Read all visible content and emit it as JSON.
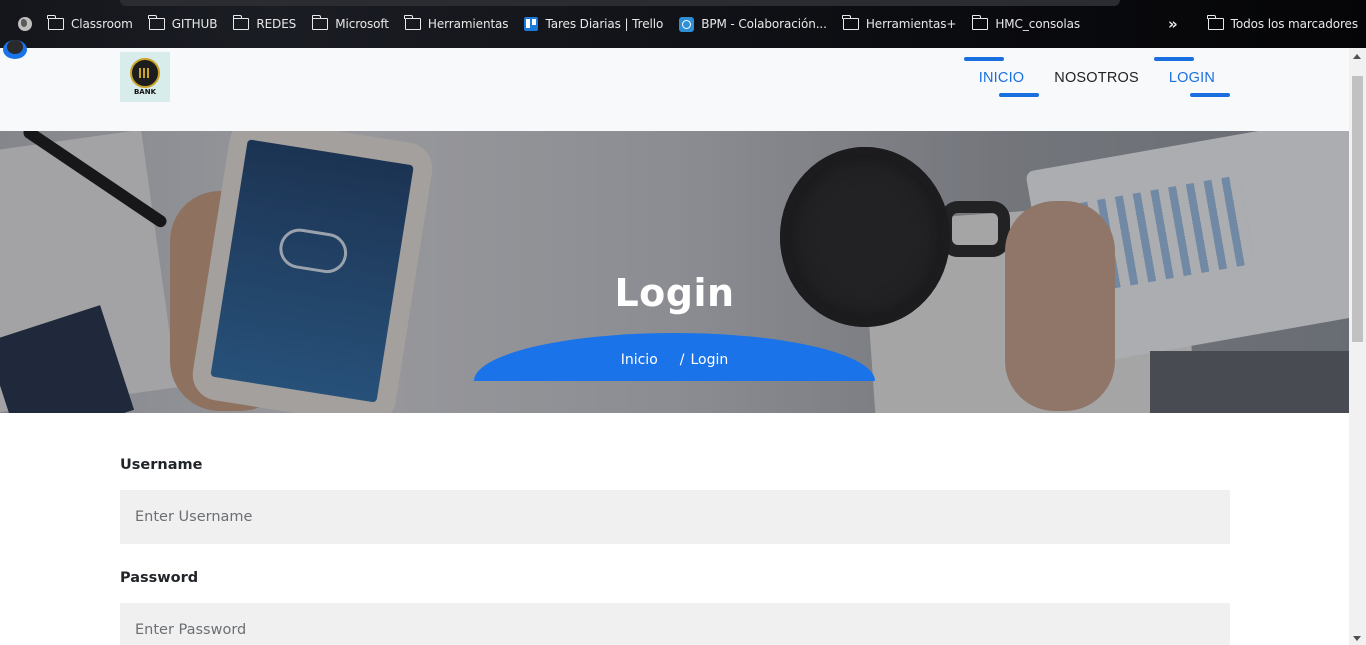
{
  "bookmarks": {
    "items": [
      {
        "label": "Classroom",
        "icon": "folder-icon"
      },
      {
        "label": "GITHUB",
        "icon": "folder-icon"
      },
      {
        "label": "REDES",
        "icon": "folder-icon"
      },
      {
        "label": "Microsoft",
        "icon": "folder-icon"
      },
      {
        "label": "Herramientas",
        "icon": "folder-icon"
      },
      {
        "label": "Tares Diarias | Trello",
        "icon": "trello-icon"
      },
      {
        "label": "BPM - Colaboración...",
        "icon": "bpm-icon"
      },
      {
        "label": "Herramientas+",
        "icon": "folder-icon"
      },
      {
        "label": "HMC_consolas",
        "icon": "folder-icon"
      }
    ],
    "overflow": "»",
    "all_bookmarks": "Todos los marcadores"
  },
  "header": {
    "logo_text": "BANK",
    "nav": [
      {
        "label": "INICIO",
        "active": true
      },
      {
        "label": "NOSOTROS",
        "active": false
      },
      {
        "label": "LOGIN",
        "active": true
      }
    ]
  },
  "hero": {
    "title": "Login",
    "breadcrumb_home": "Inicio",
    "breadcrumb_sep": "/",
    "breadcrumb_current": "Login"
  },
  "form": {
    "username_label": "Username",
    "username_placeholder": "Enter Username",
    "username_value": "",
    "password_label": "Password",
    "password_placeholder": "Enter Password",
    "password_value": ""
  },
  "colors": {
    "accent": "#1a73e8",
    "header_bg": "#f8f9fa",
    "input_bg": "#f0f0f0"
  }
}
